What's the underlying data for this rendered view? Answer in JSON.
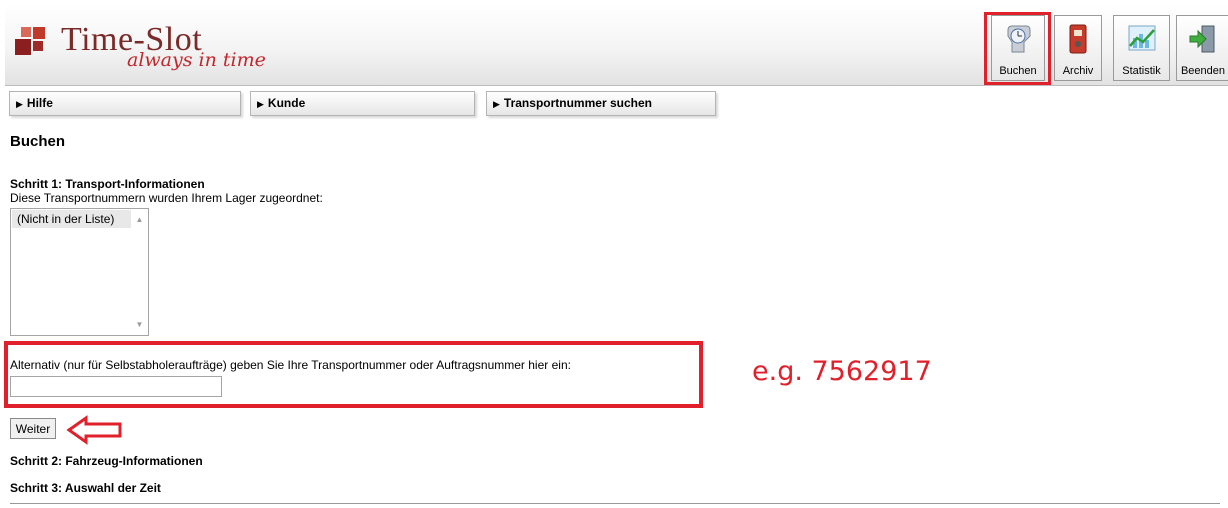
{
  "brand": {
    "title": "Time-Slot",
    "tagline": "always in time"
  },
  "toolbar": {
    "buchen": "Buchen",
    "archiv": "Archiv",
    "statistik": "Statistik",
    "beenden": "Beenden"
  },
  "nav": {
    "hilfe": "Hilfe",
    "kunde": "Kunde",
    "transportnummer": "Transportnummer suchen"
  },
  "page": {
    "title": "Buchen",
    "step1_title": "Schritt 1: Transport-Informationen",
    "step1_desc": "Diese Transportnummern wurden Ihrem Lager zugeordnet:",
    "list_options": [
      "(Nicht in der Liste)"
    ],
    "alt_label": "Alternativ (nur für Selbstabholeraufträge) geben Sie Ihre Transportnummer oder Auftragsnummer hier ein:",
    "alt_input_value": "",
    "weiter": "Weiter",
    "step2_title": "Schritt 2: Fahrzeug-Informationen",
    "step3_title": "Schritt 3: Auswahl der Zeit"
  },
  "annotation": {
    "example": "e.g. 7562917"
  },
  "colors": {
    "highlight": "#e0202a",
    "brand": "#7a2a28"
  }
}
